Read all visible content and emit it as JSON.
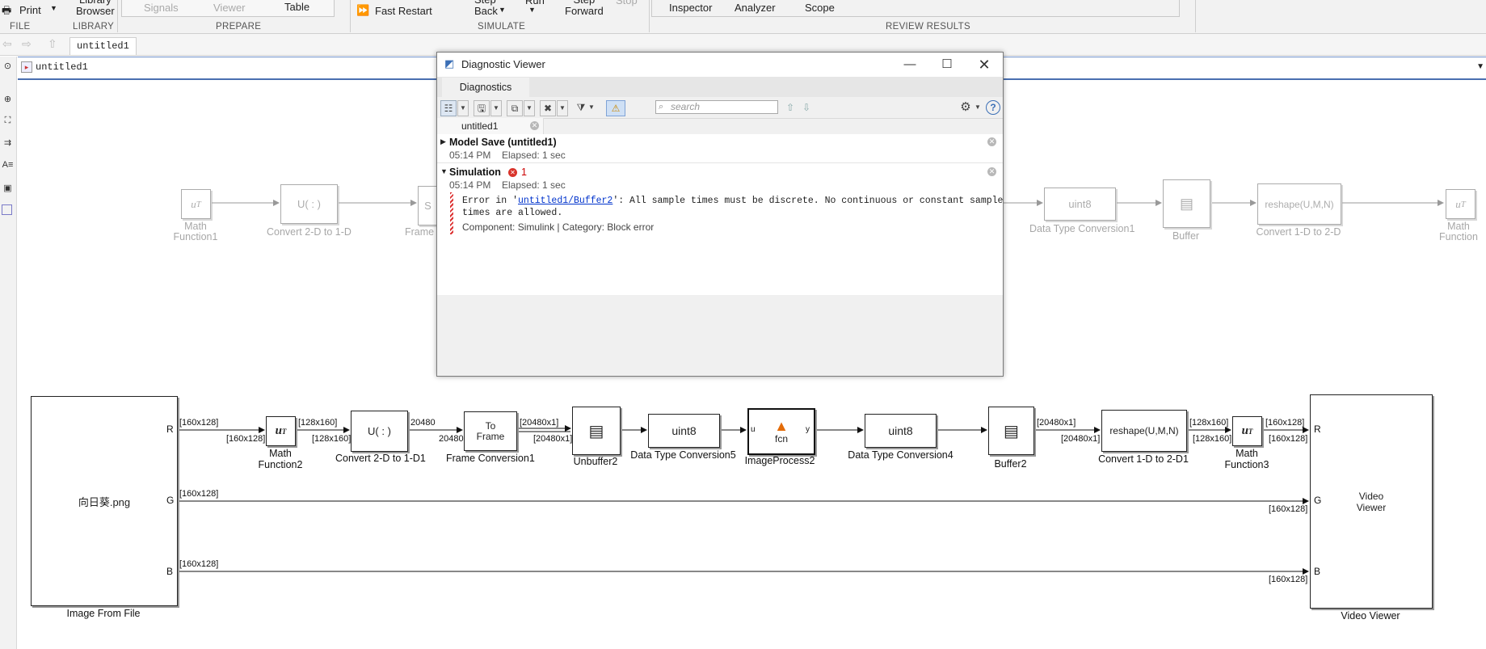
{
  "ribbon": {
    "print_label": "Print",
    "library_browser_label": "Library\nBrowser",
    "signals_label": "Signals",
    "viewer_label": "Viewer",
    "table_label": "Table",
    "fast_restart_label": "Fast Restart",
    "step_back_label": "Step\nBack",
    "run_label": "Run",
    "step_forward_label": "Step\nForward",
    "stop_label": "Stop",
    "inspector_label": "Inspector",
    "analyzer_label": "Analyzer",
    "scope_label": "Scope",
    "sections": {
      "file": "FILE",
      "library": "LIBRARY",
      "prepare": "PREPARE",
      "simulate": "SIMULATE",
      "review": "REVIEW RESULTS"
    }
  },
  "editor": {
    "tab_label": "untitled1",
    "address": "untitled1"
  },
  "dialog": {
    "title": "Diagnostic Viewer",
    "tab_label": "Diagnostics",
    "search_placeholder": "search",
    "model_tab": "untitled1",
    "entries": [
      {
        "title": "Model Save (untitled1)",
        "time": "05:14 PM",
        "elapsed": "Elapsed: 1 sec"
      },
      {
        "title": "Simulation",
        "error_count": "1",
        "time": "05:14 PM",
        "elapsed": "Elapsed: 1 sec",
        "error_prefix": "Error in '",
        "error_link": "untitled1/Buffer2",
        "error_suffix": "': All sample times must be discrete. No continuous or constant sample",
        "error_line2": "times are allowed.",
        "component_label": "Component:",
        "component": "Simulink",
        "category_label": "Category:",
        "category": "Block error"
      }
    ]
  },
  "diagram_faded": {
    "blocks": [
      {
        "label": "Math\nFunction1",
        "text": "u"
      },
      {
        "label": "Convert 2-D to 1-D",
        "text": "U( : )"
      },
      {
        "label": "Frame C",
        "text": "S"
      },
      {
        "label": "Data Type Conversion1",
        "text": "uint8"
      },
      {
        "label": "Buffer",
        "text": ""
      },
      {
        "label": "Convert 1-D to 2-D",
        "text": "reshape(U,M,N)"
      },
      {
        "label": "Math\nFunction",
        "text": "u"
      }
    ]
  },
  "diagram": {
    "image_block": {
      "text": "向日葵.png",
      "label": "Image From File",
      "ports": [
        "R",
        "G",
        "B"
      ]
    },
    "math2": {
      "label": "Math\nFunction2"
    },
    "convert1": {
      "text": "U( : )",
      "label": "Convert 2-D to 1-D1"
    },
    "frame1": {
      "text": "To\nFrame",
      "label": "Frame Conversion1"
    },
    "unbuffer2": {
      "label": "Unbuffer2"
    },
    "dtc5": {
      "text": "uint8",
      "label": "Data Type Conversion5"
    },
    "imgproc2": {
      "text": "fcn",
      "in_port": "u",
      "out_port": "y",
      "label": "ImageProcess2"
    },
    "dtc4": {
      "text": "uint8",
      "label": "Data Type Conversion4"
    },
    "buffer2": {
      "label": "Buffer2"
    },
    "reshape1": {
      "text": "reshape(U,M,N)",
      "label": "Convert 1-D to 2-D1"
    },
    "math3": {
      "label": "Math\nFunction3"
    },
    "video": {
      "text": "Video\nViewer",
      "label": "Video Viewer",
      "ports": [
        "R",
        "G",
        "B"
      ]
    },
    "signals": {
      "r_out": "[160x128]",
      "math2_in": "[160x128]",
      "math2_out": "[128x160]",
      "conv_in": "[128x160]",
      "conv_out": "20480",
      "frame_in": "20480",
      "frame_out": "[20480x1]",
      "unbuf_in": "[20480x1]",
      "buf_out": "[20480x1]",
      "reshape_in": "[20480x1]",
      "reshape_out": "[128x160]",
      "math3_in": "[128x160]",
      "math3_out": "[160x128]",
      "video_r_in": "[160x128]",
      "g_out": "[160x128]",
      "video_g_in": "[160x128]",
      "b_out": "[160x128]",
      "video_b_in": "[160x128]"
    }
  }
}
